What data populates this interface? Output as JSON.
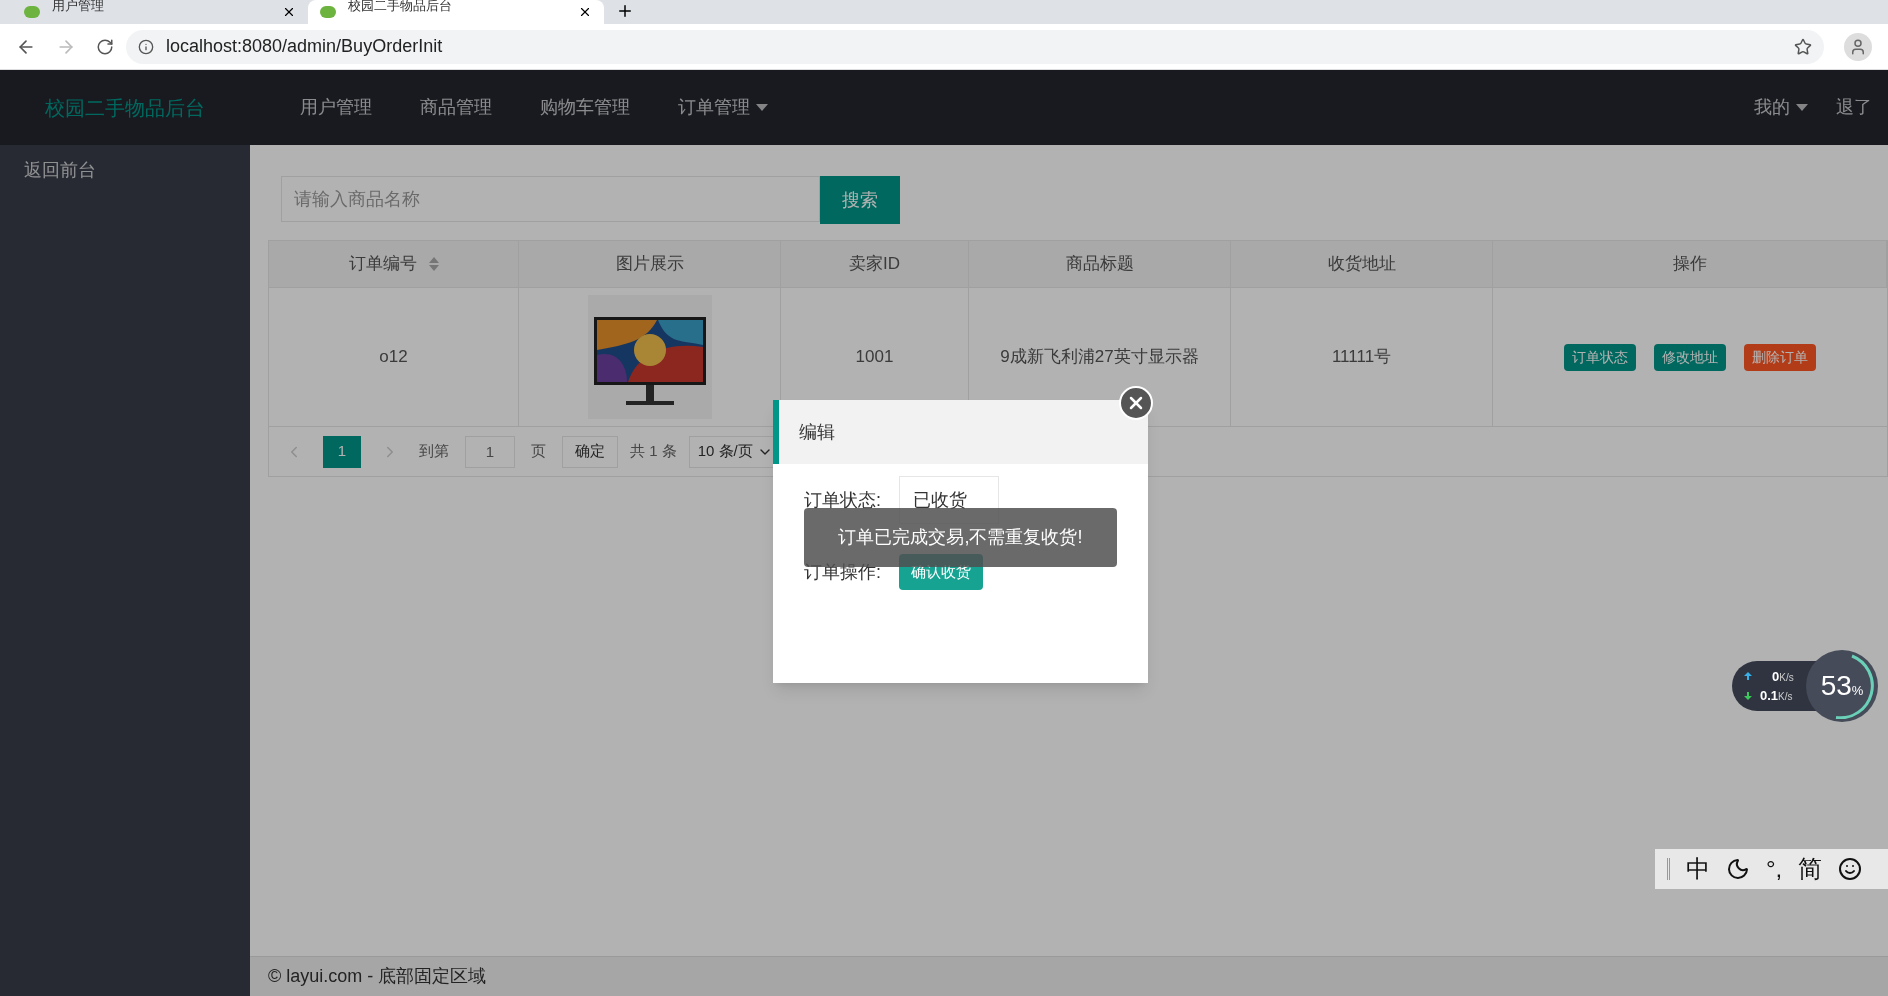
{
  "browser_tabs": [
    {
      "title": "用户管理",
      "selected": false
    },
    {
      "title": "校园二手物品后台",
      "selected": true
    }
  ],
  "address_bar": {
    "url": "localhost:8080/admin/BuyOrderInit"
  },
  "nav": {
    "brand": "校园二手物品后台",
    "items": [
      {
        "label": "用户管理",
        "dropdown": false
      },
      {
        "label": "商品管理",
        "dropdown": false
      },
      {
        "label": "购物车管理",
        "dropdown": false
      },
      {
        "label": "订单管理",
        "dropdown": true
      }
    ],
    "right": [
      {
        "label": "我的",
        "dropdown": true
      },
      {
        "label": "退了",
        "dropdown": false
      }
    ]
  },
  "sidebar": {
    "items": [
      "返回前台"
    ]
  },
  "search": {
    "placeholder": "请输入商品名称",
    "button": "搜索"
  },
  "table": {
    "columns": [
      {
        "label": "订单编号",
        "sortable": true
      },
      {
        "label": "图片展示",
        "sortable": false
      },
      {
        "label": "卖家ID",
        "sortable": false
      },
      {
        "label": "商品标题",
        "sortable": false
      },
      {
        "label": "收货地址",
        "sortable": false
      },
      {
        "label": "操作",
        "sortable": false
      }
    ],
    "rows": [
      {
        "order_no": "o12",
        "image": {
          "kind": "picture"
        },
        "seller_id": "1001",
        "title": "9成新飞利浦27英寸显示器",
        "address": "11111号",
        "actions": [
          {
            "label": "订单状态",
            "kind": "primary"
          },
          {
            "label": "修改地址",
            "kind": "primary"
          },
          {
            "label": "删除订单",
            "kind": "danger"
          }
        ]
      }
    ]
  },
  "pagination": {
    "current": "1",
    "goto_label": "到第",
    "goto_value": "1",
    "page_unit": "页",
    "confirm": "确定",
    "total": "共 1 条",
    "page_size": "10 条/页"
  },
  "dialog": {
    "title": "编辑",
    "status_label": "订单状态:",
    "status_value": "已收货",
    "operation_label": "订单操作:",
    "operation_button": "确认收货"
  },
  "toast": "订单已完成交易,不需重复收货!",
  "net_widget": {
    "up": "0",
    "up_unit": "K/s",
    "down": "0.1",
    "down_unit": "K/s",
    "percent": "53",
    "percent_sign": "%"
  },
  "ime_bar": [
    "中",
    "°,",
    "简"
  ],
  "footer": "© layui.com - 底部固定区域"
}
